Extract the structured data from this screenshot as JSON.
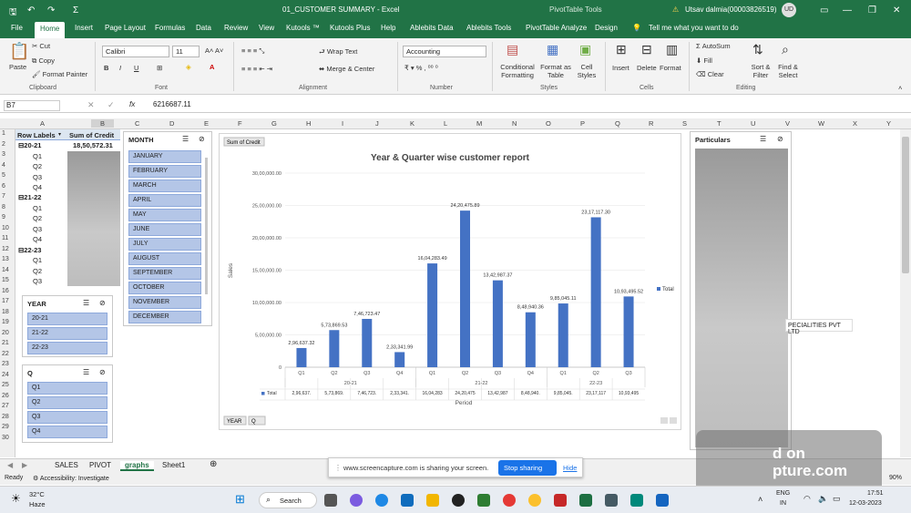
{
  "titlebar": {
    "filename": "01_CUSTOMER SUMMARY - Excel",
    "context": "PivotTable Tools",
    "user": "Utsav dalmia(00003826519)",
    "user_initials": "UD"
  },
  "tabs": [
    "File",
    "Home",
    "Insert",
    "Page Layout",
    "Formulas",
    "Data",
    "Review",
    "View",
    "Kutools ™",
    "Kutools Plus",
    "Help",
    "Ablebits Data",
    "Ablebits Tools",
    "PivotTable Analyze",
    "Design"
  ],
  "tell_me": "Tell me what you want to do",
  "ribbon": {
    "paste": "Paste",
    "cut": "Cut",
    "copy": "Copy",
    "format_painter": "Format Painter",
    "clipboard": "Clipboard",
    "font_name": "Calibri",
    "font_size": "11",
    "font": "Font",
    "wrap_text": "Wrap Text",
    "merge_center": "Merge & Center",
    "alignment": "Alignment",
    "number_format": "Accounting",
    "number": "Number",
    "cond_format": "Conditional Formatting",
    "format_table": "Format as Table",
    "cell_styles": "Cell Styles",
    "styles": "Styles",
    "insert": "Insert",
    "delete": "Delete",
    "format": "Format",
    "cells": "Cells",
    "autosum": "AutoSum",
    "fill": "Fill",
    "clear": "Clear",
    "sort_filter": "Sort & Filter",
    "find_select": "Find & Select",
    "editing": "Editing"
  },
  "formula_bar": {
    "name_box": "B7",
    "fx": "fx",
    "value": "6216687.11"
  },
  "columns": [
    "A",
    "B",
    "C",
    "D",
    "E",
    "F",
    "G",
    "H",
    "I",
    "J",
    "K",
    "L",
    "M",
    "N",
    "O",
    "P",
    "Q",
    "R",
    "S",
    "T",
    "U",
    "V",
    "W",
    "X",
    "Y"
  ],
  "rows": [
    "1",
    "2",
    "3",
    "4",
    "5",
    "6",
    "7",
    "8",
    "9",
    "10",
    "11",
    "12",
    "13",
    "14",
    "15",
    "16",
    "17",
    "18",
    "19",
    "20",
    "21",
    "22",
    "23",
    "24",
    "25",
    "26",
    "27",
    "28",
    "29",
    "30"
  ],
  "pivot": {
    "h1": "Row Labels",
    "h2": "Sum of Credit",
    "y1": "20-21",
    "y1_total": "18,50,572.31",
    "y2": "21-22",
    "y3": "22-23",
    "q": [
      "Q1",
      "Q2",
      "Q3",
      "Q4"
    ]
  },
  "slicers": {
    "month": {
      "title": "MONTH",
      "items": [
        "JANUARY",
        "FEBRUARY",
        "MARCH",
        "APRIL",
        "MAY",
        "JUNE",
        "JULY",
        "AUGUST",
        "SEPTEMBER",
        "OCTOBER",
        "NOVEMBER",
        "DECEMBER"
      ]
    },
    "year": {
      "title": "YEAR",
      "items": [
        "20-21",
        "21-22",
        "22-23"
      ]
    },
    "q": {
      "title": "Q",
      "items": [
        "Q1",
        "Q2",
        "Q3",
        "Q4"
      ]
    },
    "particulars": {
      "title": "Particulars",
      "partial_text": "PECIALITIES PVT LTD"
    }
  },
  "chart_data": {
    "type": "bar",
    "title": "Year & Quarter wise customer report",
    "field_button": "Sum of Credit",
    "xlabel": "Period",
    "ylabel": "Sales",
    "ylim": [
      0,
      3000000
    ],
    "yticks": [
      "0",
      "5,00,000.00",
      "10,00,000.00",
      "15,00,000.00",
      "20,00,000.00",
      "25,00,000.00",
      "30,00,000.00"
    ],
    "categories": [
      "Q1",
      "Q2",
      "Q3",
      "Q4",
      "Q1",
      "Q2",
      "Q3",
      "Q4",
      "Q1",
      "Q2",
      "Q3"
    ],
    "groups": [
      "20-21",
      "21-22",
      "22-23"
    ],
    "series": [
      {
        "name": "Total",
        "values": [
          296637.32,
          573869.53,
          746723.47,
          233341.99,
          1604283.49,
          2420475.89,
          1342987.37,
          848940.36,
          985045.11,
          2317117.3,
          1093495.52
        ]
      }
    ],
    "data_labels": [
      "2,96,637.32",
      "5,73,869.53",
      "7,46,723.47",
      "2,33,341.99",
      "16,04,283.49",
      "24,20,475.89",
      "13,42,987.37",
      "8,48,940.36",
      "9,85,045.11",
      "23,17,117.30",
      "10,93,495.52"
    ],
    "table_row": [
      "2,96,637.",
      "5,73,869.",
      "7,46,723.",
      "2,33,341.",
      "16,04,283",
      "24,20,475",
      "13,42,987",
      "8,48,940.",
      "9,85,045.",
      "23,17,117",
      "10,93,495"
    ],
    "legend": "Total",
    "color": "#4472c4",
    "filter_buttons": [
      "YEAR",
      "Q"
    ]
  },
  "sheets": [
    "SALES",
    "PIVOT",
    "graphs",
    "Sheet1"
  ],
  "status": {
    "ready": "Ready",
    "accessibility": "Accessibility: Investigate",
    "zoom": "90%"
  },
  "share": {
    "text": "www.screencapture.com is sharing your screen.",
    "stop": "Stop sharing",
    "hide": "Hide"
  },
  "taskbar": {
    "temp": "32°C",
    "weather": "Haze",
    "search": "Search",
    "lang": "ENG",
    "region": "IN",
    "time": "17:51",
    "date": "12-03-2023"
  },
  "watermark": "d on\npture.com"
}
